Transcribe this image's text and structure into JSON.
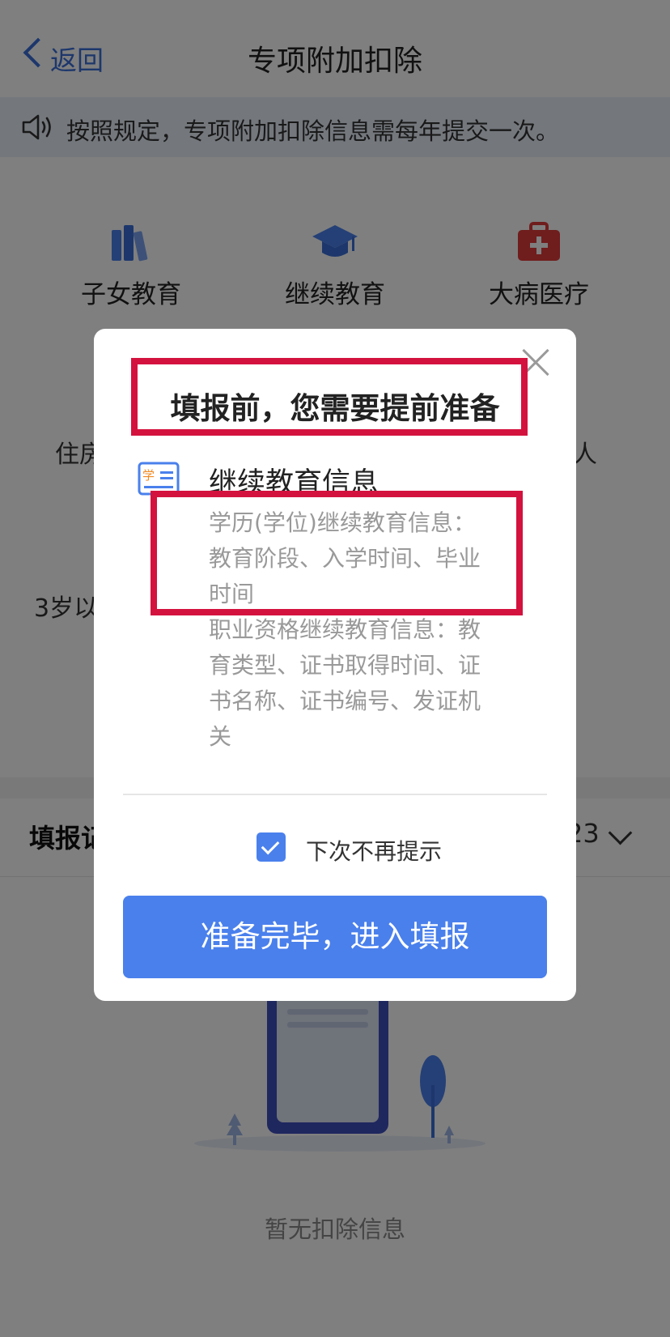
{
  "nav": {
    "back_label": "返回",
    "title": "专项附加扣除"
  },
  "notice": {
    "text": "按照规定，专项附加扣除信息需每年提交一次。"
  },
  "categories": [
    {
      "label": "子女教育",
      "icon": "books-icon",
      "color": "#4a80ec"
    },
    {
      "label": "继续教育",
      "icon": "graduation-cap-icon",
      "color": "#4a80ec"
    },
    {
      "label": "大病医疗",
      "icon": "medical-kit-icon",
      "color": "#e03a3a"
    }
  ],
  "partial_row": {
    "left": "住房",
    "right": "人"
  },
  "partial_row2": {
    "left": "3岁以"
  },
  "records": {
    "title": "填报记",
    "year": "23"
  },
  "empty_state": {
    "text": "暂无扣除信息"
  },
  "dialog": {
    "title": "填报前，您需要提前准备",
    "info_title": "继续教育信息",
    "icon_badge": "学",
    "lines": [
      "学历(学位)继续教育信息：",
      "教育阶段、入学时间、毕业",
      "时间",
      "职业资格继续教育信息：教",
      "育类型、证书取得时间、证",
      "书名称、证书编号、发证机",
      "关"
    ],
    "checkbox_label": "下次不再提示",
    "checkbox_checked": true,
    "confirm_label": "准备完毕，进入填报"
  },
  "colors": {
    "accent": "#4a80ec",
    "highlight": "#d4123e"
  }
}
